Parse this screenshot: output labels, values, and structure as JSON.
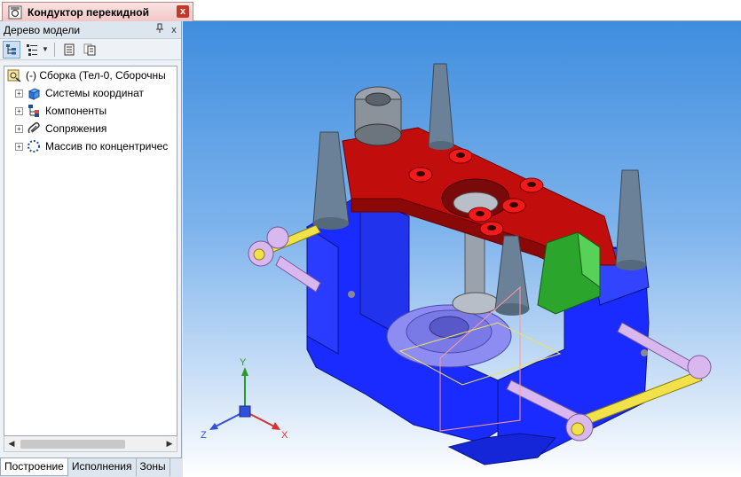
{
  "document_tab": {
    "title": "Кондуктор перекидной",
    "close_label": "x"
  },
  "panel": {
    "title": "Дерево модели",
    "pin_label": "ᵖ",
    "close_label": "x"
  },
  "tree": {
    "root_label": "(-) Сборка (Тел-0, Сборочны",
    "items": [
      {
        "label": "Системы координат",
        "icon": "coordinate-system-icon"
      },
      {
        "label": "Компоненты",
        "icon": "components-icon"
      },
      {
        "label": "Сопряжения",
        "icon": "mates-icon"
      },
      {
        "label": "Массив по концентричес",
        "icon": "circular-pattern-icon"
      }
    ]
  },
  "bottom_tabs": [
    "Построение",
    "Исполнения",
    "Зоны"
  ],
  "axes": {
    "x": "X",
    "y": "Y",
    "z": "Z"
  },
  "colors": {
    "base": "#1a2bff",
    "plate": "#c20d0d",
    "bushing": "#f21a1a",
    "pin": "#6b8197",
    "handle_bar": "#f2e24a",
    "handle_knob": "#d9b8f0",
    "green_block": "#2ca52c"
  }
}
